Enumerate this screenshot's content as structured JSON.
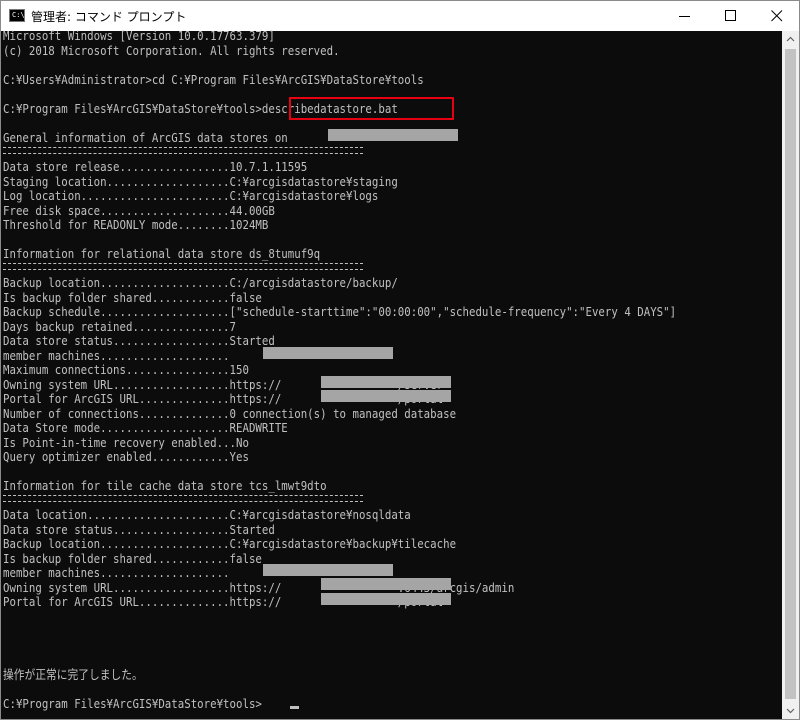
{
  "window": {
    "title": "管理者: コマンド プロンプト",
    "app_icon_text": "C:\\_"
  },
  "lines": [
    "Microsoft Windows [Version 10.0.17763.379]",
    "(c) 2018 Microsoft Corporation. All rights reserved.",
    "",
    "C:¥Users¥Administrator>cd C:¥Program Files¥ArcGIS¥DataStore¥tools",
    "",
    "C:¥Program Files¥ArcGIS¥DataStore¥tools>describedatastore.bat",
    "",
    "General information of ArcGIS data stores on",
    "",
    "Data store release.................10.7.1.11595",
    "Staging location...................C:¥arcgisdatastore¥staging",
    "Log location.......................C:¥arcgisdatastore¥logs",
    "Free disk space....................44.00GB",
    "Threshold for READONLY mode........1024MB",
    "",
    "Information for relational data store ds_8tumuf9q",
    "",
    "Backup location....................C:/arcgisdatastore/backup/",
    "Is backup folder shared............false",
    "Backup schedule....................[\"schedule-starttime\":\"00:00:00\",\"schedule-frequency\":\"Every 4 DAYS\"]",
    "Days backup retained...............7",
    "Data store status..................Started",
    "member machines....................",
    "Maximum connections................150",
    "Owning system URL..................https://                  /server",
    "Portal for ArcGIS URL..............https://                  /portal",
    "Number of connections..............0 connection(s) to managed database",
    "Data Store mode....................READWRITE",
    "Is Point-in-time recovery enabled...No",
    "Query optimizer enabled............Yes",
    "",
    "Information for tile cache data store tcs_lmwt9dto",
    "",
    "Data location......................C:¥arcgisdatastore¥nosqldata",
    "Data store status..................Started",
    "Backup location....................C:¥arcgisdatastore¥backup¥tilecache",
    "Is backup folder shared............false",
    "member machines....................",
    "Owning system URL..................https://                  :6443/arcgis/admin",
    "Portal for ArcGIS URL..............https://                  /portal",
    "",
    "",
    "",
    "",
    "操作が正常に完了しました。",
    "",
    "C:¥Program Files¥ArcGIS¥DataStore¥tools>"
  ]
}
